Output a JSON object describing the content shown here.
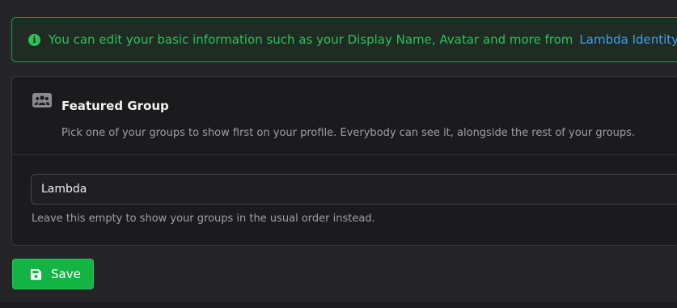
{
  "alert": {
    "icon": "info-icon",
    "message": "You can edit your basic information such as your Display Name, Avatar and more from",
    "link_label": "Lambda Identity",
    "color": "#2bc25a",
    "link_color": "#3ea0ef"
  },
  "featured_group": {
    "icon": "users-group-icon",
    "title": "Featured Group",
    "description": "Pick one of your groups to show first on your profile. Everybody can see it, alongside the rest of your groups.",
    "selected_value": "Lambda",
    "helper_text": "Leave this empty to show your groups in the usual order instead."
  },
  "actions": {
    "save_label": "Save",
    "save_icon": "save-icon",
    "save_color": "#12b543"
  }
}
